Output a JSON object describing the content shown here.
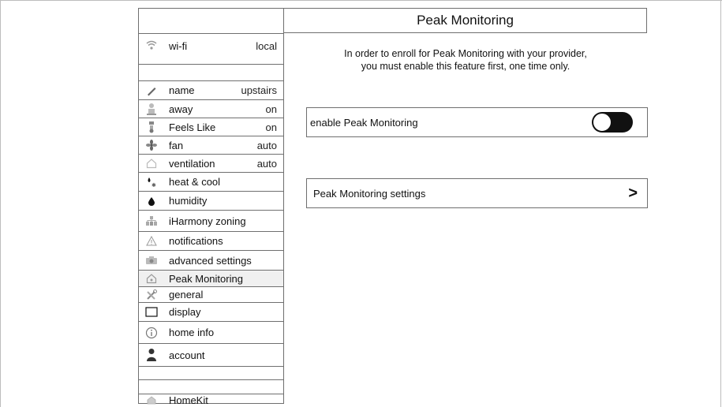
{
  "title": "Peak Monitoring",
  "info_lines": [
    "In order to enroll for Peak Monitoring with your provider,",
    "you must enable this feature first, one time only."
  ],
  "toggle": {
    "label": "enable Peak Monitoring",
    "state": "off"
  },
  "settings_link": {
    "label": "Peak Monitoring settings",
    "chevron": ">"
  },
  "sidebar": {
    "items": [
      {
        "icon": "wifi-icon",
        "label": "wi-fi",
        "value": "local"
      },
      {
        "icon": "",
        "label": "",
        "value": ""
      },
      {
        "icon": "pencil-icon",
        "label": "name",
        "value": "upstairs"
      },
      {
        "icon": "person-away-icon",
        "label": "away",
        "value": "on"
      },
      {
        "icon": "thermometer-icon",
        "label": "Feels Like",
        "value": "on"
      },
      {
        "icon": "fan-icon",
        "label": "fan",
        "value": "auto"
      },
      {
        "icon": "house-vent-icon",
        "label": "ventilation",
        "value": "auto"
      },
      {
        "icon": "flame-snow-icon",
        "label": "heat & cool",
        "value": ""
      },
      {
        "icon": "droplet-icon",
        "label": "humidity",
        "value": ""
      },
      {
        "icon": "zoning-icon",
        "label": "iHarmony zoning",
        "value": ""
      },
      {
        "icon": "warning-icon",
        "label": "notifications",
        "value": ""
      },
      {
        "icon": "advanced-settings-icon",
        "label": "advanced settings",
        "value": ""
      },
      {
        "icon": "house-icon",
        "label": "Peak Monitoring",
        "value": ""
      },
      {
        "icon": "tools-icon",
        "label": "general",
        "value": ""
      },
      {
        "icon": "display-icon",
        "label": "display",
        "value": ""
      },
      {
        "icon": "info-icon",
        "label": "home info",
        "value": ""
      },
      {
        "icon": "user-icon",
        "label": "account",
        "value": ""
      },
      {
        "icon": "",
        "label": "",
        "value": ""
      },
      {
        "icon": "",
        "label": "",
        "value": ""
      },
      {
        "icon": "homekit-icon",
        "label": "HomeKit",
        "value": ""
      }
    ]
  }
}
